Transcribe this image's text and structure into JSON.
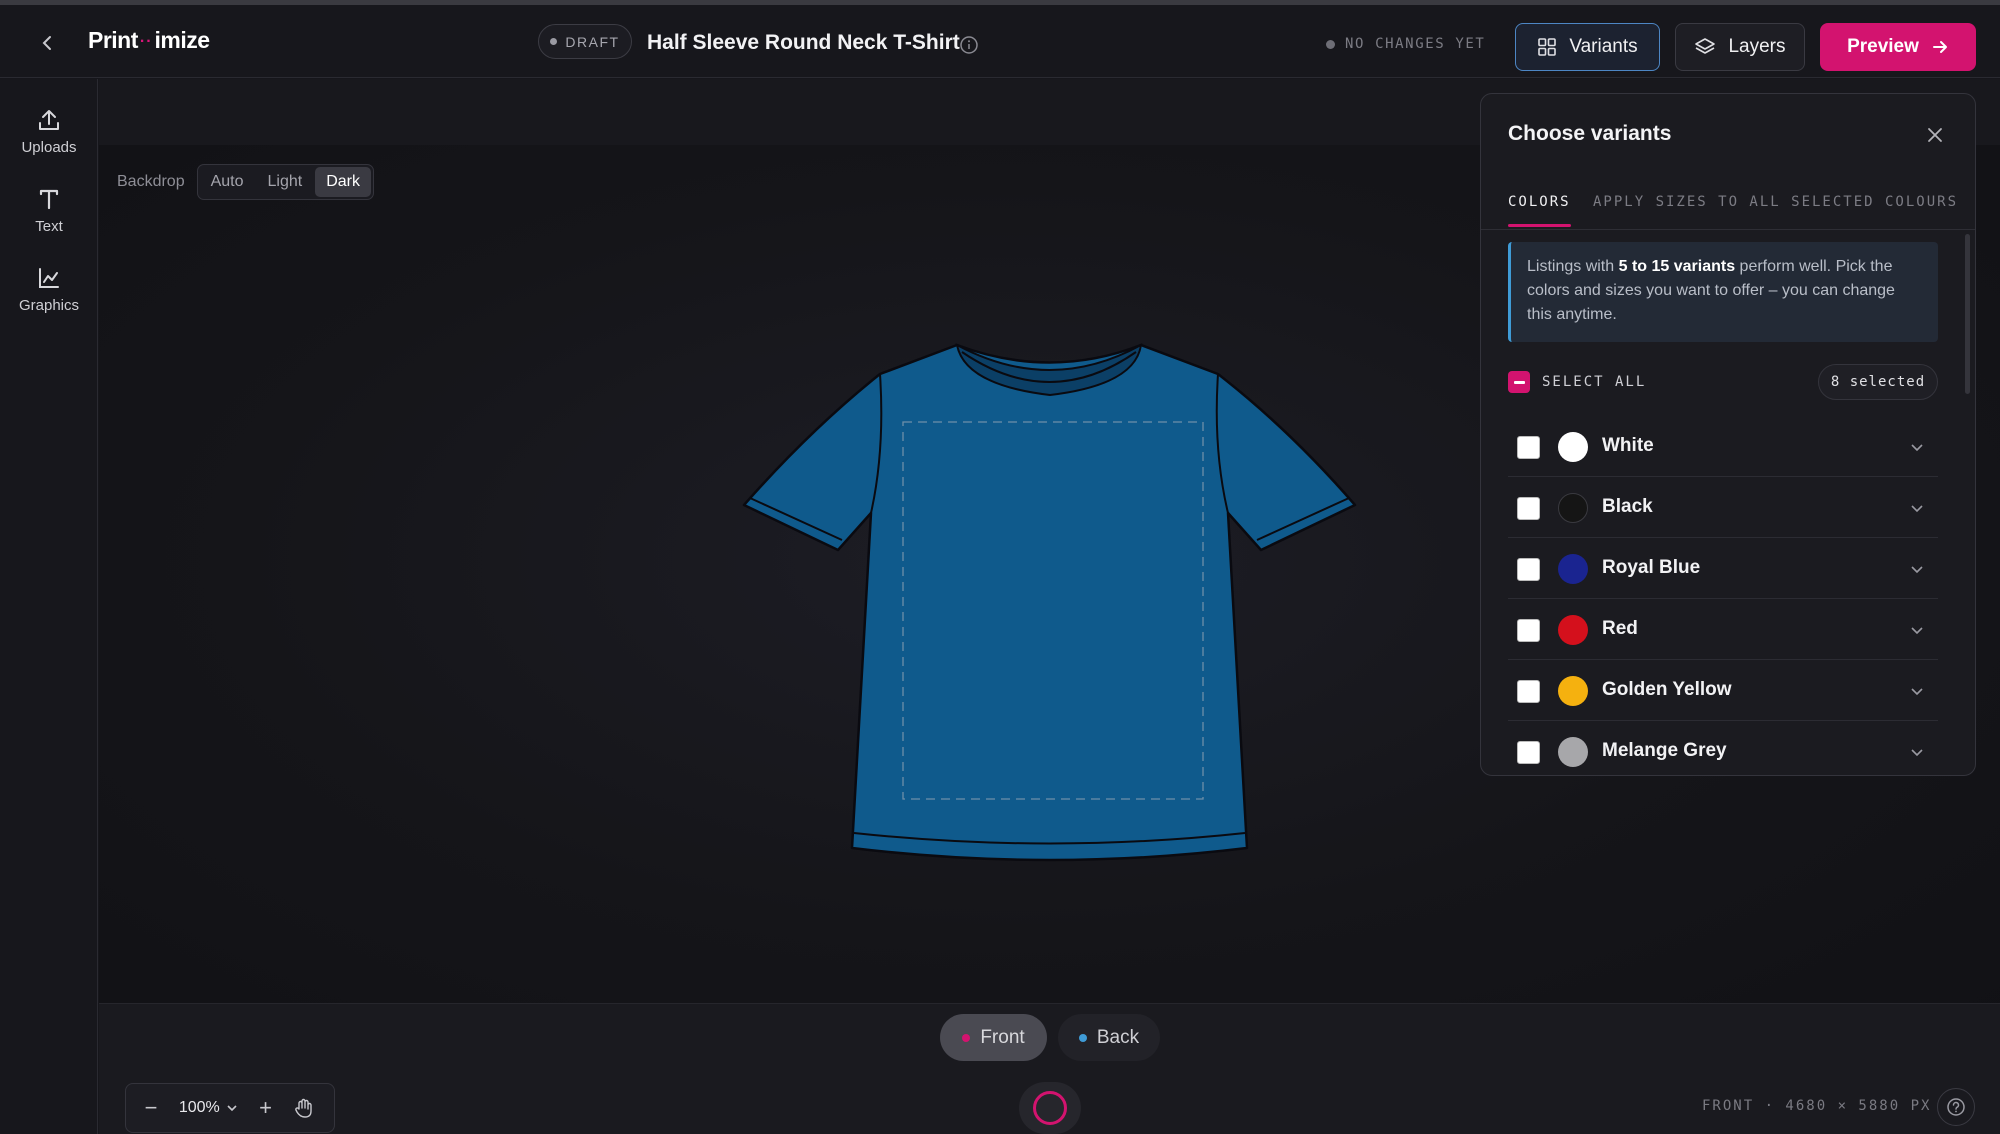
{
  "app": {
    "logo_left": "Print",
    "logo_dots": "··",
    "logo_right": "imize",
    "draft_label": "DRAFT",
    "title": "Half Sleeve Round Neck T-Shirt",
    "status": "NO CHANGES YET"
  },
  "toolbar": {
    "variants_label": "Variants",
    "layers_label": "Layers",
    "preview_label": "Preview"
  },
  "sidebar": {
    "items": [
      {
        "label": "Uploads",
        "icon": "upload-icon"
      },
      {
        "label": "Text",
        "icon": "text-icon"
      },
      {
        "label": "Graphics",
        "icon": "chart-icon"
      }
    ]
  },
  "canvas": {
    "backdrop_label": "Backdrop",
    "backdrop_options": [
      "Auto",
      "Light",
      "Dark"
    ],
    "backdrop_selected": "Dark",
    "shirt_color": "#0f5a8c"
  },
  "bottom": {
    "front_label": "Front",
    "back_label": "Back",
    "zoom": "100%",
    "dims": "FRONT · 4680 × 5880 PX"
  },
  "variants_panel": {
    "title": "Choose variants",
    "tabs": [
      "COLORS",
      "APPLY SIZES TO ALL SELECTED COLOURS"
    ],
    "info_prefix": "Listings with ",
    "info_bold": "5 to 15 variants",
    "info_suffix": " perform well. Pick the colors and sizes you want to offer – you can change this anytime.",
    "select_all_label": "SELECT ALL",
    "selected_count": "8 selected",
    "colors": [
      {
        "name": "White",
        "hex": "#ffffff"
      },
      {
        "name": "Black",
        "hex": "#151515"
      },
      {
        "name": "Royal Blue",
        "hex": "#1a2490"
      },
      {
        "name": "Red",
        "hex": "#d4101c"
      },
      {
        "name": "Golden Yellow",
        "hex": "#f5b10f"
      },
      {
        "name": "Melange Grey",
        "hex": "#a7a7aa"
      }
    ]
  },
  "colors": {
    "accent": "#d3136f",
    "info_border": "#3f9bd6",
    "front_dot": "#d3136f",
    "back_dot": "#3f9bd6"
  }
}
